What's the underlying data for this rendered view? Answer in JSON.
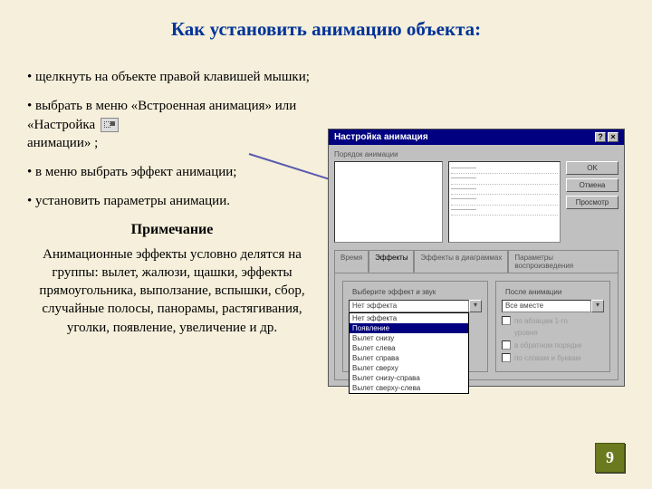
{
  "title": "Как установить анимацию объекта:",
  "bullets": {
    "b1": "• щелкнуть на объекте правой клавишей мышки;",
    "b2a": "• выбрать в меню «Встроенная анимация» или «Настройка ",
    "b2b": " анимации»       ;",
    "b3": "• в меню выбрать эффект анимации;",
    "b4": "• установить параметры анимации."
  },
  "note_title": "Примечание",
  "note_body": "Анимационные эффекты условно делятся на группы: вылет, жалюзи, щашки, эффекты прямоугольника, выползание, вспышки, сбор, случайные полосы, панорамы, растягивания, уголки, появление, увеличение и др.",
  "page_number": "9",
  "dialog": {
    "title": "Настройка анимация",
    "section_label": "Порядок анимации",
    "buttons": {
      "ok": "OK",
      "cancel": "Отмена",
      "preview": "Просмотр"
    },
    "tabs": {
      "t1": "Время",
      "t2": "Эффекты",
      "t3": "Эффекты в диаграммах",
      "t4": "Параметры воспроизведения"
    },
    "group1_label": "Выберите эффект и звук",
    "group2_label": "После анимации",
    "combo1_value": "Нет эффекта",
    "combo2_value": "Все вместе",
    "effects_list": [
      "Нет эффекта",
      "Появление",
      "Вылет снизу",
      "Вылет слева",
      "Вылет справа",
      "Вылет сверху",
      "Вылет снизу-справа",
      "Вылет сверху-слева"
    ],
    "selected_effect": "Нет эффекта",
    "chk1": "по абзацам   1-го",
    "chk1b": "уровня",
    "chk2": "в обратном порядке",
    "chk3": "по словам и буквам",
    "order_lines": [
      "————",
      "————",
      "————",
      "————",
      "————"
    ]
  }
}
